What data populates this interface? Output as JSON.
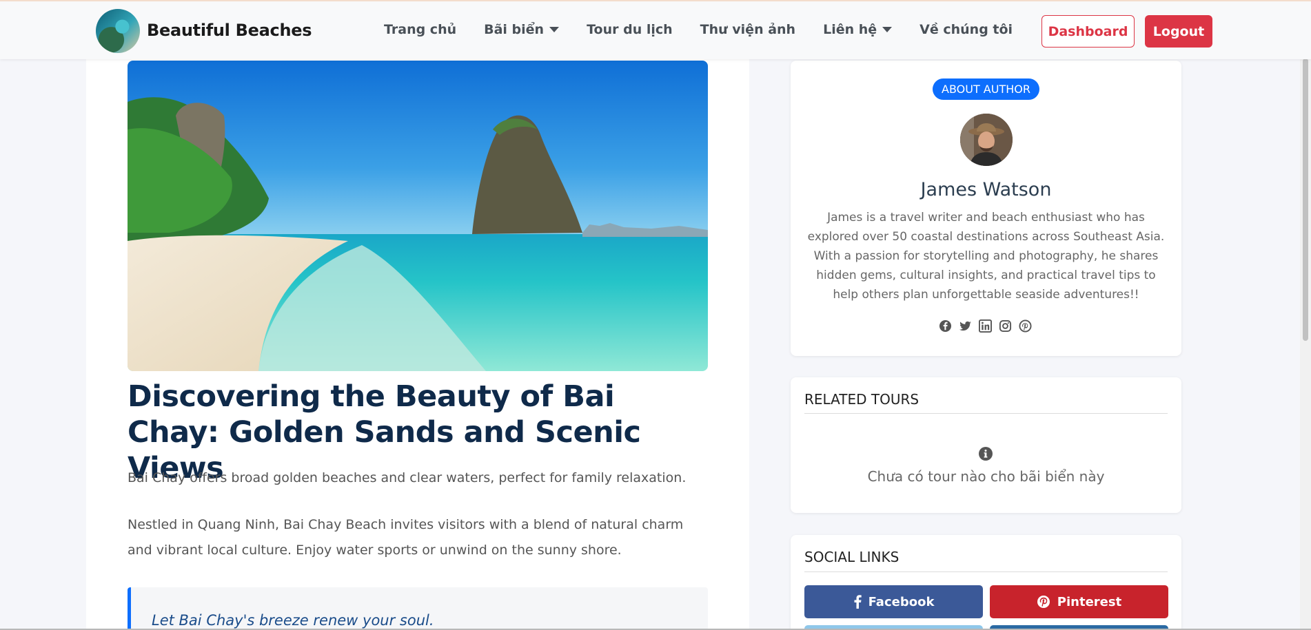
{
  "header": {
    "brand": "Beautiful Beaches",
    "nav": [
      {
        "label": "Trang chủ",
        "dropdown": false
      },
      {
        "label": "Bãi biển",
        "dropdown": true
      },
      {
        "label": "Tour du lịch",
        "dropdown": false
      },
      {
        "label": "Thư viện ảnh",
        "dropdown": false
      },
      {
        "label": "Liên hệ",
        "dropdown": true
      },
      {
        "label": "Về chúng tôi",
        "dropdown": false
      }
    ],
    "dashboard_label": "Dashboard",
    "logout_label": "Logout"
  },
  "article": {
    "title": "Discovering the Beauty of Bai Chay: Golden Sands and Scenic Views",
    "lead": "Bai Chay offers broad golden beaches and clear waters, perfect for family relaxation.",
    "body": "Nestled in Quang Ninh, Bai Chay Beach invites visitors with a blend of natural charm and vibrant local culture. Enjoy water sports or unwind on the sunny shore.",
    "quote": "Let Bai Chay's breeze renew your soul."
  },
  "author": {
    "badge": "ABOUT AUTHOR",
    "name": "James Watson",
    "bio": "James is a travel writer and beach enthusiast who has explored over 50 coastal destinations across Southeast Asia. With a passion for storytelling and photography, he shares hidden gems, cultural insights, and practical travel tips to help others plan unforgettable seaside adventures!!",
    "social_icons": [
      "facebook-icon",
      "twitter-icon",
      "linkedin-icon",
      "instagram-icon",
      "pinterest-icon"
    ]
  },
  "related_tours": {
    "heading": "RELATED TOURS",
    "empty_message": "Chưa có tour nào cho bãi biển này"
  },
  "social_links": {
    "heading": "SOCIAL LINKS",
    "facebook_label": "Facebook",
    "pinterest_label": "Pinterest"
  },
  "colors": {
    "accent": "#0d6efd",
    "danger": "#dc3545",
    "facebook": "#3b5998",
    "pinterest": "#c8232c",
    "title": "#0f2a4a"
  }
}
